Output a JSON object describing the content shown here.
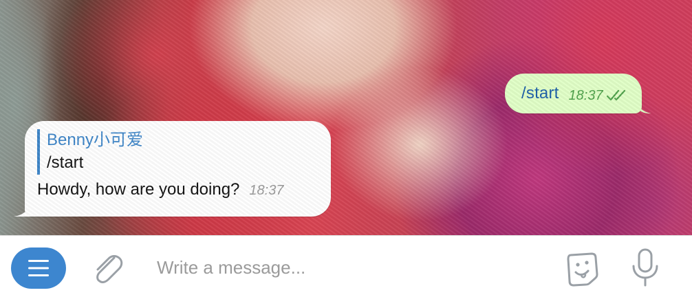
{
  "conversation": {
    "outgoing": {
      "text": "/start",
      "time": "18:37",
      "status_icon": "double-check-icon",
      "bubble_color": "#e1ffc7"
    },
    "incoming": {
      "reply_author": "Benny小可爱",
      "reply_text": "/start",
      "text": "Howdy, how are you doing?",
      "time": "18:37"
    }
  },
  "composer": {
    "placeholder": "Write a message...",
    "value": "",
    "menu_icon": "menu-icon",
    "attach_icon": "paperclip-icon",
    "sticker_icon": "sticker-icon",
    "mic_icon": "microphone-icon",
    "accent_color": "#3d86cf"
  }
}
